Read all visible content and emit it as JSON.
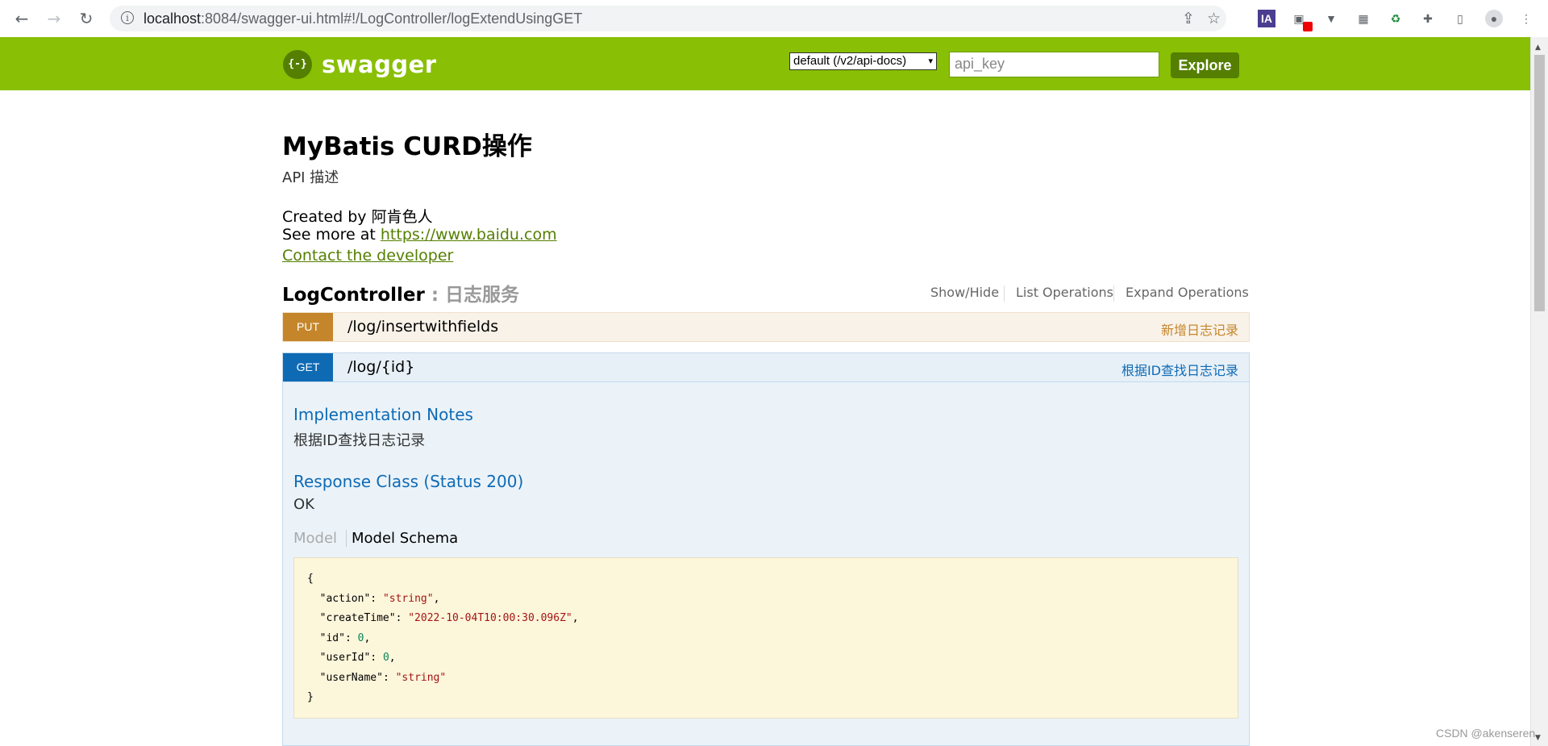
{
  "browser": {
    "url_host": "localhost",
    "url_rest": ":8084/swagger-ui.html#!/LogController/logExtendUsingGET",
    "info_glyph": "i",
    "back_icon": "←",
    "forward_icon": "→",
    "reload_icon": "↻",
    "share_icon": "⇪",
    "star_icon": "☆",
    "extensions": [
      "IA",
      "▣",
      "▼",
      "▦",
      "♻",
      "✚",
      "▯",
      "●",
      "⋮"
    ]
  },
  "header": {
    "logo_symbol": "{-}",
    "logo_text": "swagger",
    "spec_selected": "default (/v2/api-docs)",
    "select_arrow": "▾",
    "api_key_placeholder": "api_key",
    "explore_label": "Explore",
    "brand_color": "#89bf04"
  },
  "info": {
    "title": "MyBatis CURD操作",
    "description": "API 描述",
    "created_by": "Created by 阿肯色人",
    "see_more_prefix": "See more at ",
    "see_more_link": "https://www.baidu.com",
    "contact_link": "Contact the developer"
  },
  "controller": {
    "name": "LogController",
    "description": " : 日志服务",
    "ops": {
      "show_hide": "Show/Hide",
      "list_operations": "List Operations",
      "expand_operations": "Expand Operations"
    }
  },
  "operations": [
    {
      "method": "PUT",
      "path": "/log/insertwithfields",
      "summary": "新增日志记录",
      "color": "#c5862b"
    },
    {
      "method": "GET",
      "path": "/log/{id}",
      "summary": "根据ID查找日志记录",
      "color": "#0f6ab4"
    }
  ],
  "detail": {
    "impl_title": "Implementation Notes",
    "impl_text": "根据ID查找日志记录",
    "response_title": "Response Class (Status 200)",
    "response_text": "OK",
    "tab_model": "Model",
    "tab_schema": "Model Schema",
    "schema": {
      "open": "{",
      "close": "}",
      "fields": [
        {
          "key": "\"action\"",
          "value": "\"string\"",
          "kind": "str",
          "comma": true
        },
        {
          "key": "\"createTime\"",
          "value": "\"2022-10-04T10:00:30.096Z\"",
          "kind": "str",
          "comma": true
        },
        {
          "key": "\"id\"",
          "value": "0",
          "kind": "num",
          "comma": true
        },
        {
          "key": "\"userId\"",
          "value": "0",
          "kind": "num",
          "comma": true
        },
        {
          "key": "\"userName\"",
          "value": "\"string\"",
          "kind": "str",
          "comma": false
        }
      ]
    }
  },
  "watermark": "CSDN @akenseren"
}
